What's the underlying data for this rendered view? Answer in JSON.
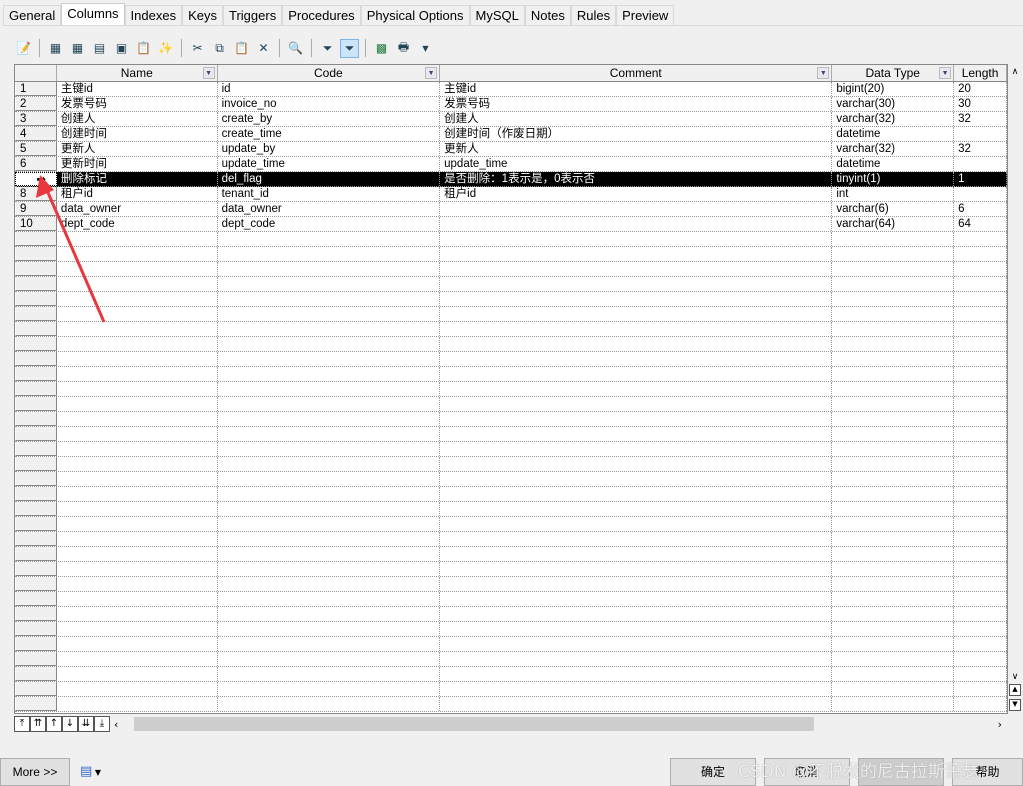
{
  "tabs": [
    "General",
    "Columns",
    "Indexes",
    "Keys",
    "Triggers",
    "Procedures",
    "Physical Options",
    "MySQL",
    "Notes",
    "Rules",
    "Preview"
  ],
  "active_tab": "Columns",
  "columns": [
    "Name",
    "Code",
    "Comment",
    "Data Type",
    "Length"
  ],
  "rows": [
    [
      "1",
      "主键id",
      "id",
      "主键id",
      "bigint(20)",
      "20"
    ],
    [
      "2",
      "发票号码",
      "invoice_no",
      "发票号码",
      "varchar(30)",
      "30"
    ],
    [
      "3",
      "创建人",
      "create_by",
      "创建人",
      "varchar(32)",
      "32"
    ],
    [
      "4",
      "创建时间",
      "create_time",
      "创建时间（作废日期）",
      "datetime",
      ""
    ],
    [
      "5",
      "更新人",
      "update_by",
      "更新人",
      "varchar(32)",
      "32"
    ],
    [
      "6",
      "更新时间",
      "update_time",
      "update_time",
      "datetime",
      ""
    ],
    [
      "➡",
      "删除标记",
      "del_flag",
      "是否删除：1表示是，0表示否",
      "tinyint(1)",
      "1"
    ],
    [
      "8",
      "租户id",
      "tenant_id",
      "租户id",
      "int",
      ""
    ],
    [
      "9",
      "data_owner",
      "data_owner",
      "",
      "varchar(6)",
      "6"
    ],
    [
      "10",
      "dept_code",
      "dept_code",
      "",
      "varchar(64)",
      "64"
    ]
  ],
  "selected_row": 7,
  "footer": {
    "more": "More >>",
    "ok": "确定",
    "cancel": "取消",
    "apply": "",
    "help": "帮助"
  },
  "watermark": "CSDN @不脱发的尼古拉斯萧瑟",
  "colors": {
    "selection": "#000000",
    "annotation_arrow": "#e8383d"
  }
}
